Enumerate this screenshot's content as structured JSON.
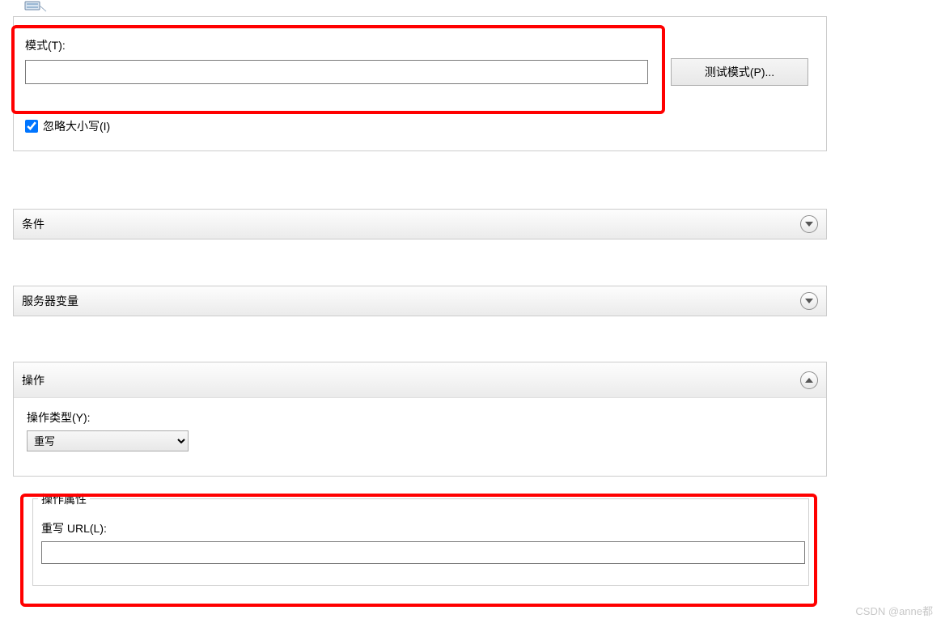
{
  "pattern": {
    "label": "模式(T):",
    "value": "",
    "test_button_label": "测试模式(P)...",
    "ignore_case_label": "忽略大小写(I)",
    "ignore_case_checked": true
  },
  "sections": {
    "conditions": {
      "title": "条件"
    },
    "server_vars": {
      "title": "服务器变量"
    },
    "action": {
      "title": "操作",
      "type_label": "操作类型(Y):",
      "type_value": "重写",
      "properties_legend": "操作属性",
      "rewrite_url_label": "重写 URL(L):",
      "rewrite_url_value": ""
    }
  },
  "watermark": "CSDN @anne都"
}
